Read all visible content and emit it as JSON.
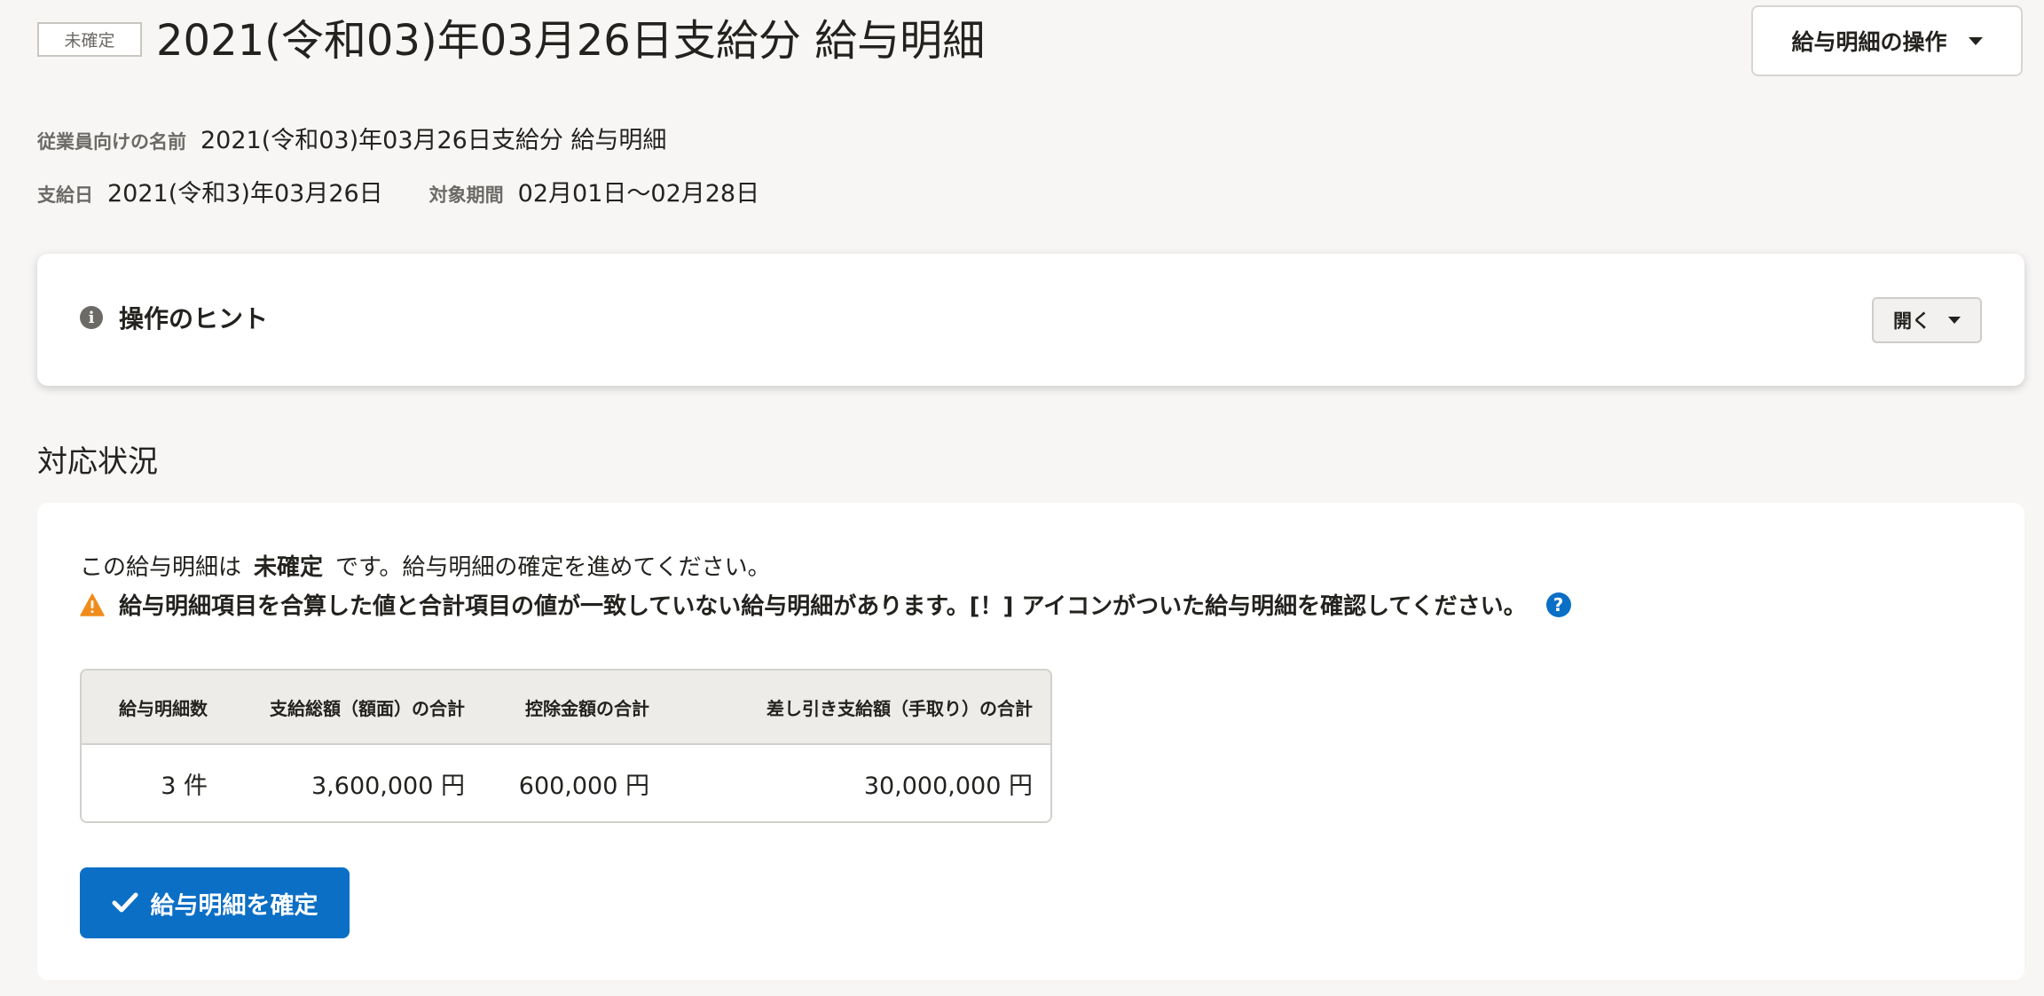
{
  "header": {
    "status_tag": "未確定",
    "title": "2021(令和03)年03月26日支給分 給与明細",
    "actions_label": "給与明細の操作"
  },
  "meta": {
    "employee_name_label": "従業員向けの名前",
    "employee_name_value": "2021(令和03)年03月26日支給分 給与明細",
    "pay_date_label": "支給日",
    "pay_date_value": "2021(令和3)年03月26日",
    "period_label": "対象期間",
    "period_value": "02月01日〜02月28日"
  },
  "hint": {
    "icon": "info-icon",
    "title": "操作のヒント",
    "open_label": "開く"
  },
  "status_section": {
    "heading": "対応状況",
    "message_prefix": "この給与明細は",
    "message_status": "未確定",
    "message_suffix": "です。給与明細の確定を進めてください。",
    "warning_icon": "warning-icon",
    "warning_text": "給与明細項目を合算した値と合計項目の値が一致していない給与明細があります。[！] アイコンがついた給与明細を確認してください。",
    "help_icon": "help-icon",
    "help_glyph": "?",
    "table": {
      "headers": [
        "給与明細数",
        "支給総額（額面）の合計",
        "控除金額の合計",
        "差し引き支給額（手取り）の合計"
      ],
      "values": [
        "3 件",
        "3,600,000 円",
        "600,000 円",
        "30,000,000 円"
      ]
    },
    "confirm_label": "給与明細を確定"
  },
  "colors": {
    "background": "#f7f6f5",
    "primary": "#0b6fc6",
    "warning": "#f08c1a",
    "muted_text": "#6c6a66"
  }
}
